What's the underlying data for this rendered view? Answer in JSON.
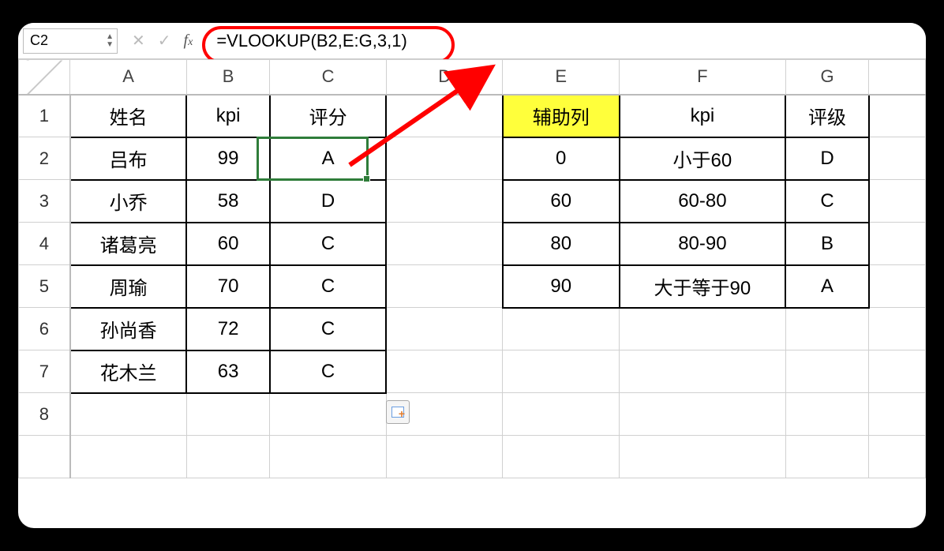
{
  "formula_bar": {
    "cell_ref": "C2",
    "formula": "=VLOOKUP(B2,E:G,3,1)"
  },
  "columns": [
    "A",
    "B",
    "C",
    "D",
    "E",
    "F",
    "G"
  ],
  "row_numbers": [
    "1",
    "2",
    "3",
    "4",
    "5",
    "6",
    "7",
    "8"
  ],
  "left_table": {
    "headers": {
      "A": "姓名",
      "B": "kpi",
      "C": "评分"
    },
    "rows": [
      {
        "name": "吕布",
        "kpi": "99",
        "grade": "A"
      },
      {
        "name": "小乔",
        "kpi": "58",
        "grade": "D"
      },
      {
        "name": "诸葛亮",
        "kpi": "60",
        "grade": "C"
      },
      {
        "name": "周瑜",
        "kpi": "70",
        "grade": "C"
      },
      {
        "name": "孙尚香",
        "kpi": "72",
        "grade": "C"
      },
      {
        "name": "花木兰",
        "kpi": "63",
        "grade": "C"
      }
    ]
  },
  "right_table": {
    "headers": {
      "E": "辅助列",
      "F": "kpi",
      "G": "评级"
    },
    "rows": [
      {
        "aux": "0",
        "range": "小于60",
        "lvl": "D"
      },
      {
        "aux": "60",
        "range": "60-80",
        "lvl": "C"
      },
      {
        "aux": "80",
        "range": "80-90",
        "lvl": "B"
      },
      {
        "aux": "90",
        "range": "大于等于90",
        "lvl": "A"
      }
    ]
  }
}
